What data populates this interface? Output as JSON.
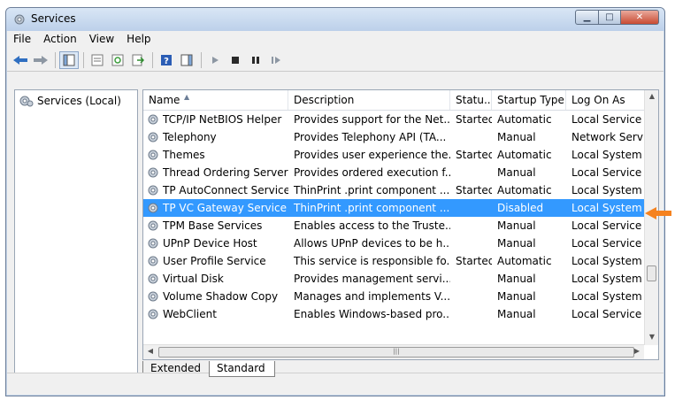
{
  "window": {
    "title": "Services"
  },
  "menu": [
    "File",
    "Action",
    "View",
    "Help"
  ],
  "toolbar_icons": [
    "back-arrow-icon",
    "forward-arrow-icon",
    "show-hide-tree-icon",
    "properties-icon",
    "refresh-icon",
    "export-list-icon",
    "help-icon",
    "show-hide-action-pane-icon",
    "start-service-icon",
    "stop-service-icon",
    "pause-service-icon",
    "resume-service-icon"
  ],
  "tree": {
    "root_label": "Services (Local)"
  },
  "columns": {
    "name": "Name",
    "description": "Description",
    "status": "Statu...",
    "startup": "Startup Type",
    "logon": "Log On As"
  },
  "services": [
    {
      "name": "TCP/IP NetBIOS Helper",
      "description": "Provides support for the Net...",
      "status": "Started",
      "startup": "Automatic",
      "logon": "Local Service"
    },
    {
      "name": "Telephony",
      "description": "Provides Telephony API (TA...",
      "status": "",
      "startup": "Manual",
      "logon": "Network Service"
    },
    {
      "name": "Themes",
      "description": "Provides user experience the...",
      "status": "Started",
      "startup": "Automatic",
      "logon": "Local System"
    },
    {
      "name": "Thread Ordering Server",
      "description": "Provides ordered execution f...",
      "status": "",
      "startup": "Manual",
      "logon": "Local Service"
    },
    {
      "name": "TP AutoConnect Service",
      "description": "ThinPrint .print component ...",
      "status": "Started",
      "startup": "Automatic",
      "logon": "Local System"
    },
    {
      "name": "TP VC Gateway Service",
      "description": "ThinPrint .print component ...",
      "status": "",
      "startup": "Disabled",
      "logon": "Local System",
      "selected": true
    },
    {
      "name": "TPM Base Services",
      "description": "Enables access to the Truste...",
      "status": "",
      "startup": "Manual",
      "logon": "Local Service"
    },
    {
      "name": "UPnP Device Host",
      "description": "Allows UPnP devices to be h...",
      "status": "",
      "startup": "Manual",
      "logon": "Local Service"
    },
    {
      "name": "User Profile Service",
      "description": "This service is responsible fo...",
      "status": "Started",
      "startup": "Automatic",
      "logon": "Local System"
    },
    {
      "name": "Virtual Disk",
      "description": "Provides management servi...",
      "status": "",
      "startup": "Manual",
      "logon": "Local System"
    },
    {
      "name": "Volume Shadow Copy",
      "description": "Manages and implements V...",
      "status": "",
      "startup": "Manual",
      "logon": "Local System"
    },
    {
      "name": "WebClient",
      "description": "Enables Windows-based pro...",
      "status": "",
      "startup": "Manual",
      "logon": "Local Service"
    }
  ],
  "tabs": [
    "Extended",
    "Standard"
  ],
  "colors": {
    "selection": "#3399ff",
    "pointer_arrow": "#f5821f"
  }
}
